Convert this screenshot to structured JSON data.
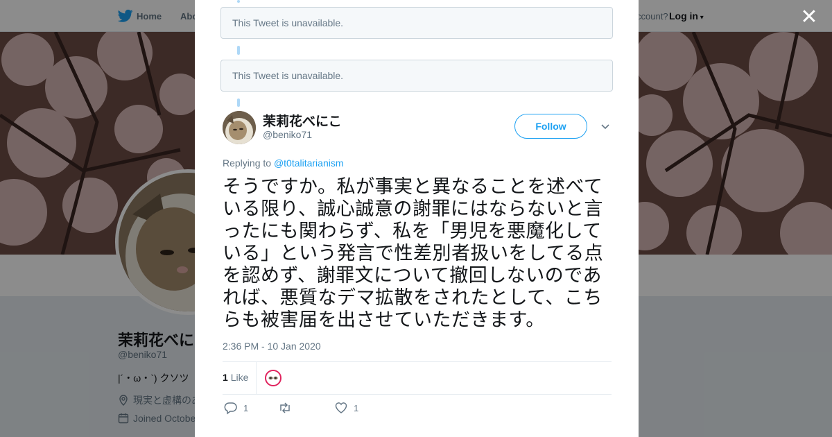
{
  "background_page": {
    "nav": {
      "home_label": "Home",
      "about_label": "Abo",
      "account_prompt": "ccount?",
      "login_label": "Log in"
    },
    "profile": {
      "name": "茉莉花べにこ",
      "handle": "@beniko71",
      "bio": "|´・ω・`) クソツ",
      "location": "現実と虚構のあ",
      "joined": "Joined Octobe"
    }
  },
  "modal": {
    "close_symbol": "✕",
    "unavailable_notices": [
      "This Tweet is unavailable.",
      "This Tweet is unavailable."
    ],
    "tweet": {
      "author_name": "茉莉花べにこ",
      "author_handle": "@beniko71",
      "follow_label": "Follow",
      "replying_prefix": "Replying to ",
      "replying_to": "@t0talitarianism",
      "text": "そうですか。私が事実と異なることを述べている限り、誠心誠意の謝罪にはならないと言ったにも関わらず、私を「男児を悪魔化している」という発言で性差別者扱いをしてる点を認めず、謝罪文について撤回しないのであれば、悪質なデマ拡散をされたとして、こちらも被害届を出させていただきます。",
      "timestamp": "2:36 PM - 10 Jan 2020",
      "like_count": "1",
      "like_label": "Like",
      "actions": {
        "reply_count": "1",
        "retweet_count": "",
        "like_count": "1"
      }
    }
  },
  "colors": {
    "accent": "#1da1f2",
    "thread_line": "#aed8f7",
    "text_primary": "#14171a",
    "text_secondary": "#657786"
  },
  "icons": [
    "twitter-bird-icon",
    "caret-down-icon",
    "close-icon",
    "location-icon",
    "calendar-icon",
    "reply-icon",
    "retweet-icon",
    "heart-icon"
  ]
}
